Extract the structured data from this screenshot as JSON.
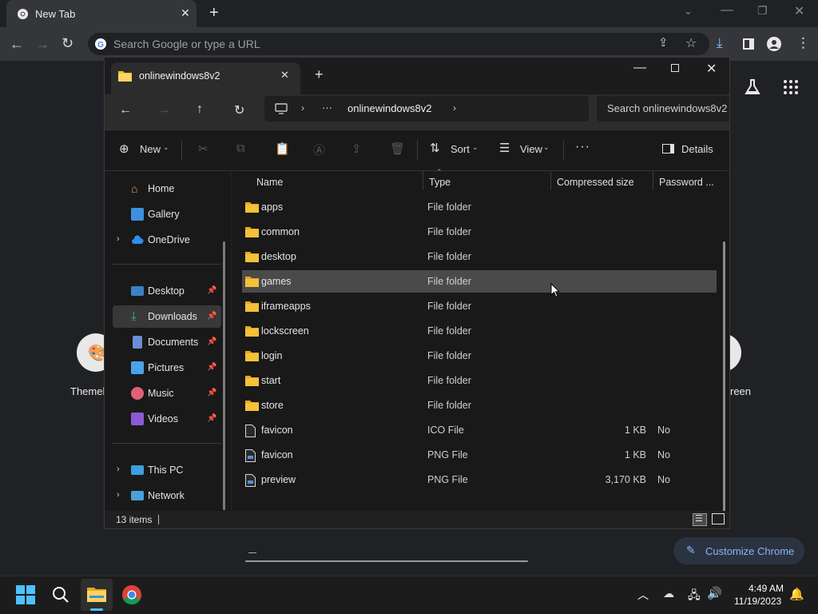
{
  "chrome": {
    "tab_title": "New Tab",
    "omnibox_placeholder": "Search Google or type a URL",
    "shortcut_left_label": "Themel",
    "shortcut_right_label": "reen",
    "customize_label": "Customize Chrome"
  },
  "explorer": {
    "tab_title": "onlinewindows8v2",
    "breadcrumb_more": "···",
    "breadcrumb_current": "onlinewindows8v2",
    "search_placeholder": "Search onlinewindows8v2",
    "cmd": {
      "new_label": "New",
      "sort_label": "Sort",
      "view_label": "View",
      "more_label": "···",
      "details_label": "Details"
    },
    "columns": {
      "name": "Name",
      "type": "Type",
      "compressed": "Compressed size",
      "password": "Password ..."
    },
    "nav": {
      "home": "Home",
      "gallery": "Gallery",
      "onedrive": "OneDrive",
      "desktop": "Desktop",
      "downloads": "Downloads",
      "documents": "Documents",
      "pictures": "Pictures",
      "music": "Music",
      "videos": "Videos",
      "thispc": "This PC",
      "network": "Network"
    },
    "files": [
      {
        "name": "apps",
        "type": "File folder",
        "size": "",
        "pw": ""
      },
      {
        "name": "common",
        "type": "File folder",
        "size": "",
        "pw": ""
      },
      {
        "name": "desktop",
        "type": "File folder",
        "size": "",
        "pw": ""
      },
      {
        "name": "games",
        "type": "File folder",
        "size": "",
        "pw": ""
      },
      {
        "name": "iframeapps",
        "type": "File folder",
        "size": "",
        "pw": ""
      },
      {
        "name": "lockscreen",
        "type": "File folder",
        "size": "",
        "pw": ""
      },
      {
        "name": "login",
        "type": "File folder",
        "size": "",
        "pw": ""
      },
      {
        "name": "start",
        "type": "File folder",
        "size": "",
        "pw": ""
      },
      {
        "name": "store",
        "type": "File folder",
        "size": "",
        "pw": ""
      },
      {
        "name": "favicon",
        "type": "ICO File",
        "size": "1 KB",
        "pw": "No"
      },
      {
        "name": "favicon",
        "type": "PNG File",
        "size": "1 KB",
        "pw": "No"
      },
      {
        "name": "preview",
        "type": "PNG File",
        "size": "3,170 KB",
        "pw": "No"
      }
    ],
    "status_items": "13 items"
  },
  "taskbar": {
    "time": "4:49 AM",
    "date": "11/19/2023"
  },
  "colors": {
    "folder": "#f3c13a",
    "accent": "#4cc2ff",
    "selection": "#4a4a4a"
  }
}
